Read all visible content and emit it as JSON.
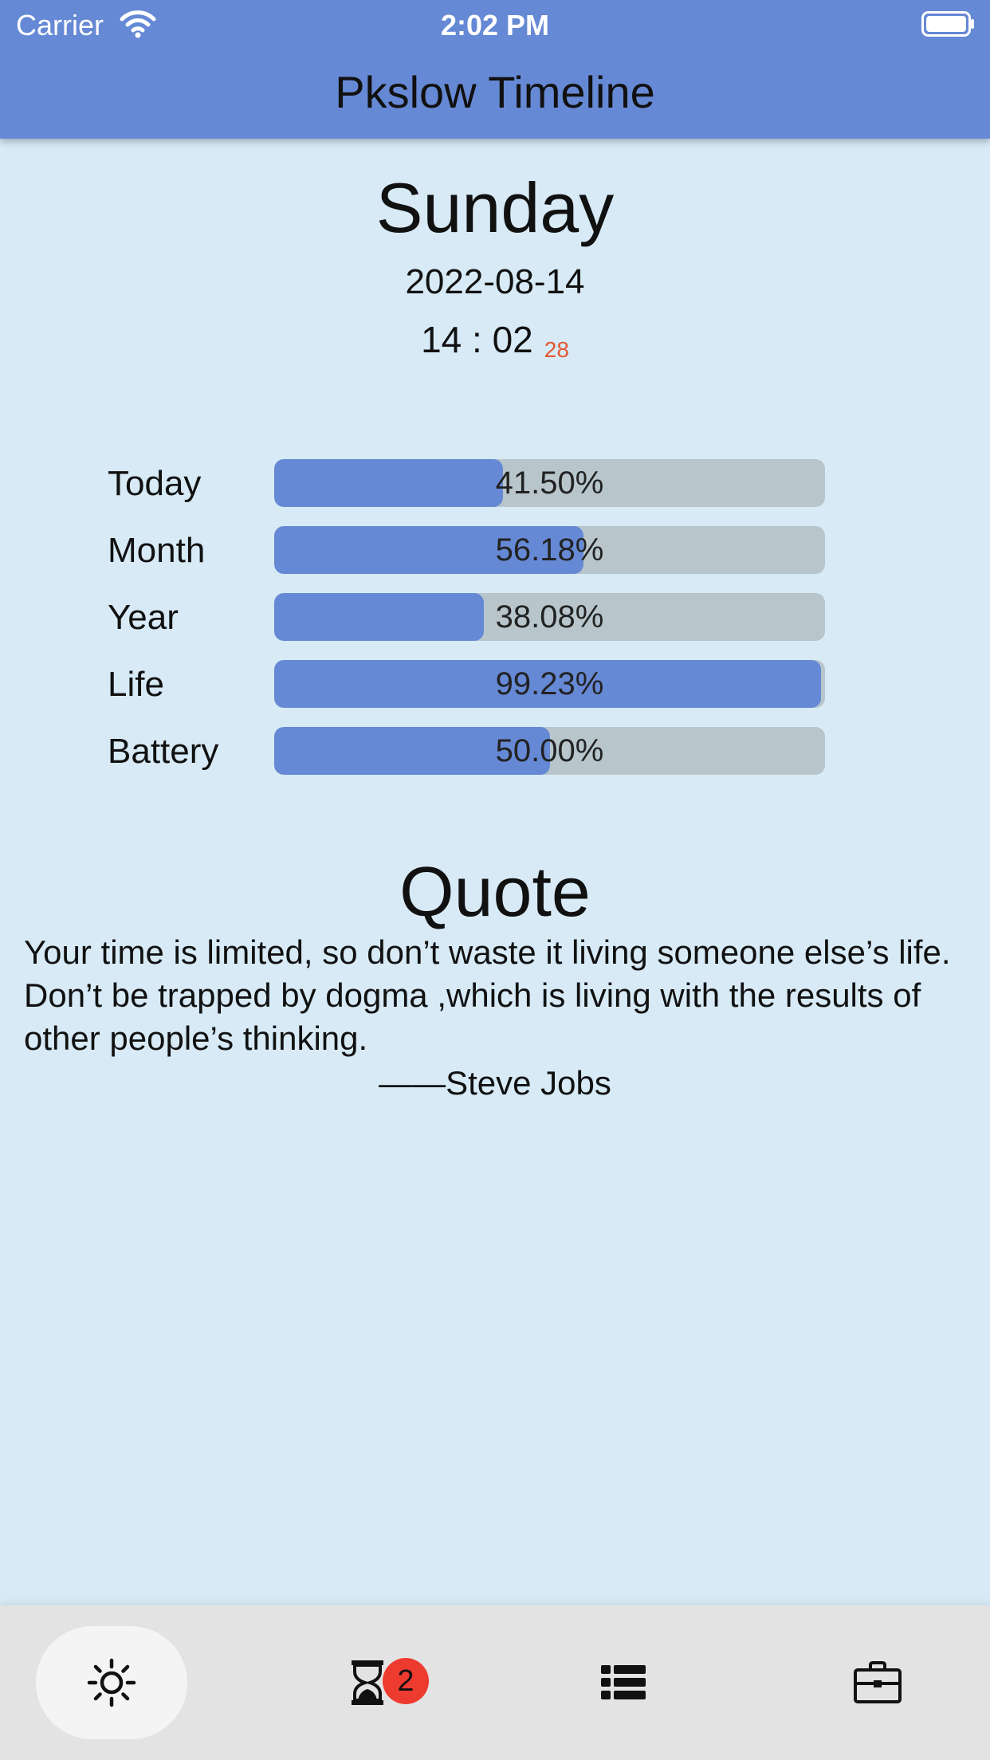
{
  "status_bar": {
    "carrier": "Carrier",
    "time": "2:02 PM"
  },
  "app_bar": {
    "title": "Pkslow Timeline",
    "color": "#6689D5"
  },
  "date_block": {
    "day": "Sunday",
    "date": "2022-08-14",
    "clock_hm": "14 : 02",
    "clock_seconds": "28"
  },
  "progress": [
    {
      "label": "Today",
      "value_text": "41.50%",
      "fraction": 0.415
    },
    {
      "label": "Month",
      "value_text": "56.18%",
      "fraction": 0.5618
    },
    {
      "label": "Year",
      "value_text": "38.08%",
      "fraction": 0.3808
    },
    {
      "label": "Life",
      "value_text": "99.23%",
      "fraction": 0.9923
    },
    {
      "label": "Battery",
      "value_text": "50.00%",
      "fraction": 0.5
    }
  ],
  "quote": {
    "heading": "Quote",
    "text": "Your time is limited, so don’t waste it living someone else’s life. Don’t be trapped by dogma ,which is living with the results of other people’s thinking.",
    "author": "——Steve Jobs"
  },
  "bottom_nav": {
    "items": [
      {
        "icon": "sun-icon",
        "active": true
      },
      {
        "icon": "hourglass-icon",
        "badge": "2"
      },
      {
        "icon": "list-icon"
      },
      {
        "icon": "briefcase-icon"
      }
    ]
  }
}
